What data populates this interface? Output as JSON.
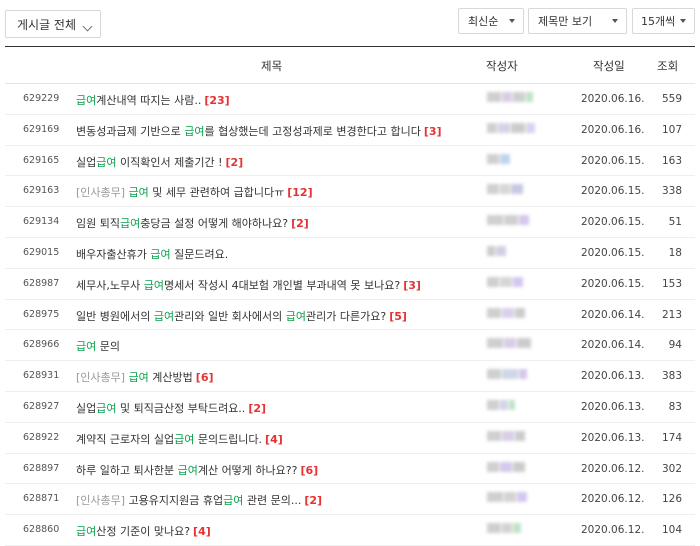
{
  "filters": {
    "board": "게시글 전체",
    "sort": "최신순",
    "view": "제목만 보기",
    "count": "15개씩"
  },
  "table": {
    "headers": {
      "title": "제목",
      "author": "작성자",
      "date": "작성일",
      "views": "조회"
    },
    "rows": [
      {
        "num": "629229",
        "prefix": "",
        "before": "",
        "keyword": "급여",
        "after": "계산내역 따지는 사람..",
        "comments": "[23]",
        "date": "2020.06.16.",
        "views": "559"
      },
      {
        "num": "629169",
        "prefix": "",
        "before": "변동성과급제 기반으로 ",
        "keyword": "급여",
        "after": "를 협상했는데 고정성과제로 변경한다고 합니다",
        "comments": "[3]",
        "date": "2020.06.16.",
        "views": "107"
      },
      {
        "num": "629165",
        "prefix": "",
        "before": "실업",
        "keyword": "급여",
        "after": " 이직확인서 제출기간 !",
        "comments": "[2]",
        "date": "2020.06.15.",
        "views": "163"
      },
      {
        "num": "629163",
        "prefix": "[인사총무] ",
        "before": "",
        "keyword": "급여",
        "after": " 및 세무 관련하여 급합니다ㅠ",
        "comments": "[12]",
        "date": "2020.06.15.",
        "views": "338"
      },
      {
        "num": "629134",
        "prefix": "",
        "before": "임원 퇴직",
        "keyword": "급여",
        "after": "충당금 설정 어떻게 해야하나요?",
        "comments": "[2]",
        "date": "2020.06.15.",
        "views": "51"
      },
      {
        "num": "629015",
        "prefix": "",
        "before": "배우자출산휴가 ",
        "keyword": "급여",
        "after": " 질문드려요.",
        "comments": "",
        "date": "2020.06.15.",
        "views": "18"
      },
      {
        "num": "628987",
        "prefix": "",
        "before": "세무사,노무사 ",
        "keyword": "급여",
        "after": "명세서 작성시 4대보험 개인별 부과내역 못 보나요?",
        "comments": "[3]",
        "date": "2020.06.15.",
        "views": "153"
      },
      {
        "num": "628975",
        "prefix": "",
        "before": "일반 병원에서의 ",
        "keyword": "급여",
        "after": "관리와 일반 회사에서의 ",
        "keyword2": "급여",
        "after2": "관리가 다른가요?",
        "comments": "[5]",
        "date": "2020.06.14.",
        "views": "213"
      },
      {
        "num": "628966",
        "prefix": "",
        "before": "",
        "keyword": "급여",
        "after": " 문의",
        "comments": "",
        "date": "2020.06.14.",
        "views": "94"
      },
      {
        "num": "628931",
        "prefix": "[인사총무] ",
        "before": "",
        "keyword": "급여",
        "after": " 계산방법",
        "comments": "[6]",
        "date": "2020.06.13.",
        "views": "383"
      },
      {
        "num": "628927",
        "prefix": "",
        "before": "실업",
        "keyword": "급여",
        "after": " 및 퇴직금산정 부탁드려요..",
        "comments": "[2]",
        "date": "2020.06.13.",
        "views": "83"
      },
      {
        "num": "628922",
        "prefix": "",
        "before": "계약직 근로자의 실업",
        "keyword": "급여",
        "after": " 문의드립니다.",
        "comments": "[4]",
        "date": "2020.06.13.",
        "views": "174"
      },
      {
        "num": "628897",
        "prefix": "",
        "before": "하루 일하고 퇴사한분 ",
        "keyword": "급여",
        "after": "계산 어떻게 하나요??",
        "comments": "[6]",
        "date": "2020.06.12.",
        "views": "302"
      },
      {
        "num": "628871",
        "prefix": "[인사총무] ",
        "before": "고용유지지원금 휴업",
        "keyword": "급여",
        "after": " 관련 문의...",
        "comments": "[2]",
        "date": "2020.06.12.",
        "views": "126"
      },
      {
        "num": "628860",
        "prefix": "",
        "before": "",
        "keyword": "급여",
        "after": "산정 기준이 맞나요?",
        "comments": "[4]",
        "date": "2020.06.12.",
        "views": "104"
      }
    ]
  }
}
